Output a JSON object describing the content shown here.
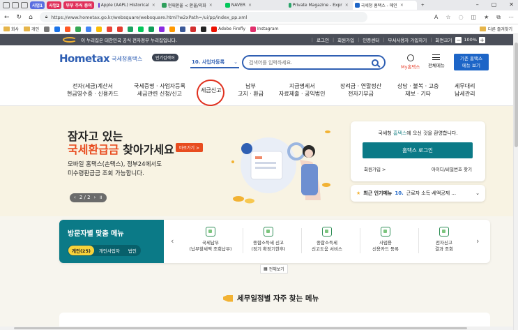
{
  "tabs": [
    {
      "label": "사업1",
      "color": "#5a6ee0",
      "pill": true
    },
    {
      "label": "사업2",
      "color": "#e0305a",
      "pill": true
    },
    {
      "label": "부부 주식 증여",
      "color": "#e0305a",
      "pill": true
    },
    {
      "label": "Apple (AAPL) Historical",
      "pill": false
    },
    {
      "label": "현재환율 < 환율/외화",
      "pill": false
    },
    {
      "label": "NAVER",
      "pill": false
    },
    {
      "label": "Private Magazine - Expr",
      "pill": false
    },
    {
      "label": "국세청 홈택스 - 메인",
      "pill": false,
      "active": true
    }
  ],
  "url": "https://www.hometax.go.kr/websquare/websquare.html?w2xPath=/ui/pp/index_pp.xml",
  "bookmarks": {
    "items": [
      "회사",
      "개인"
    ],
    "adobe": "Adobe Firefly",
    "instagram": "Instagram",
    "other": "다른 즐겨찾기"
  },
  "topstrip": {
    "notice": "이 누리집은 대한민국 공식 전자정부 누리집입니다.",
    "links": [
      "로그인",
      "회원가입",
      "인증센터",
      "부서사용자 가입하기",
      "화면크기"
    ],
    "zoom": "100%"
  },
  "header": {
    "logo": "Hometax",
    "logo_sub": "국세청홈택스",
    "search_label": "인기검색어",
    "search_select": "10. 사업자등록",
    "search_placeholder": "검색어를 입력하세요.",
    "myhome": "My홈택스",
    "allmenu": "전체메뉴",
    "basic_btn_1": "기존 홈택스",
    "basic_btn_2": "메뉴 보기"
  },
  "nav": [
    {
      "label": "전자(세금)계산서\n현금영수증 · 신용카드"
    },
    {
      "label": "국세증명 · 사업자등록\n세금관련 신청/신고"
    },
    {
      "label": "세금신고"
    },
    {
      "label": "납부\n고지 · 환급"
    },
    {
      "label": "지급명세서\n자료제출 · 공익법인"
    },
    {
      "label": "장려금 · 연말정산\n전자기부금"
    },
    {
      "label": "상담 · 불복 · 고충\n제보 · 기타"
    },
    {
      "label": "세무대리\n납세관리"
    }
  ],
  "hero": {
    "line1": "잠자고 있는",
    "line2_highlight": "국세환급금",
    "line2_rest": " 찾아가세요",
    "shortcut": "바로가기 >",
    "desc": "모바일 홈택스(손택스), 정부24에서도\n미수령환급금 조회 가능합니다.",
    "pager": "2 / 2"
  },
  "login": {
    "welcome_pre": "국세청 ",
    "welcome_hl": "홈택스",
    "welcome_post": "에 오신 것을 환영합니다.",
    "login_btn": "홈택스 로그인",
    "join": "회원가입 >",
    "find": "아이디/비밀번호 찾기"
  },
  "popular": {
    "label": "최근 인기메뉴",
    "num": "10.",
    "item": "근로자 소득·세액공제 ..."
  },
  "visitor": {
    "title": "방문자별 맞춤 메뉴",
    "tabs": [
      "개인(25)",
      "개인사업자",
      "법인"
    ],
    "items": [
      {
        "label": "국세납부\n(납부할세액 조회납부)"
      },
      {
        "label": "종합소득세 신고\n(정기 확정기한후)"
      },
      {
        "label": "종합소득세\n신고도움 서비스"
      },
      {
        "label": "사업용\n신용카드 등록"
      },
      {
        "label": "전자신고\n결과 조회"
      }
    ],
    "allview": "전체보기"
  },
  "schedule": {
    "title": "세무일정별 자주 찾는 메뉴"
  }
}
